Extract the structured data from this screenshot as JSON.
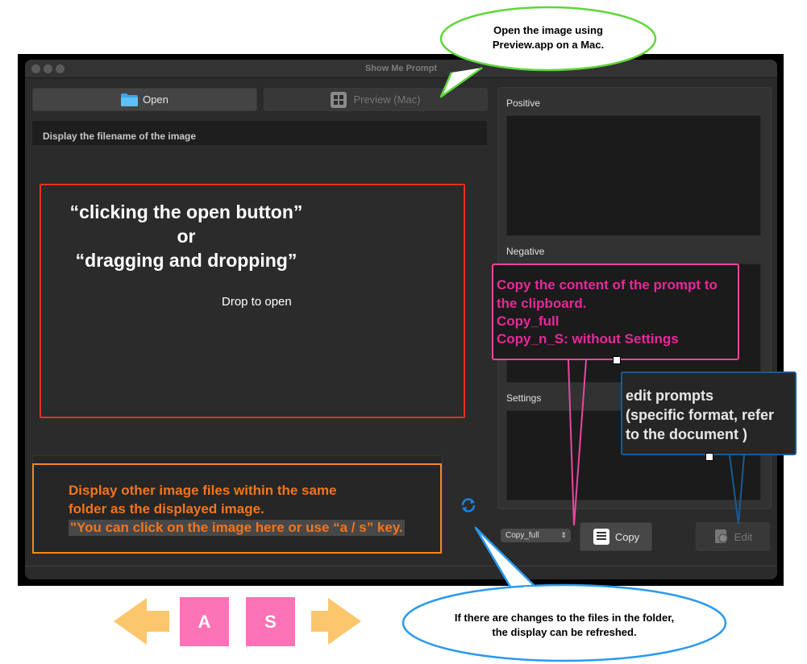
{
  "window": {
    "title": "Show Me Prompt"
  },
  "toolbar": {
    "open_label": "Open",
    "preview_label": "Preview (Mac)"
  },
  "filename": {
    "text": "Display the filename of the image"
  },
  "drop": {
    "label": "Drop to open"
  },
  "prompts": {
    "positive_label": "Positive",
    "negative_label": "Negative",
    "settings_label": "Settings"
  },
  "controls": {
    "copy_mode": "Copy_full",
    "copy_label": "Copy",
    "edit_label": "Edit"
  },
  "annotations": {
    "open_hint": [
      "“clicking the open button”",
      "or",
      "“dragging and dropping”"
    ],
    "preview_bubble": [
      "Open the image using",
      "Preview.app on a Mac."
    ],
    "thumbs_hint": [
      "Display other image files within the same",
      "folder as the displayed image.",
      "\"You can click on the image here or use “a / s” key."
    ],
    "copy_hint": [
      "Copy the content of the prompt to",
      "the clipboard.",
      "Copy_full",
      "Copy_n_S: without Settings"
    ],
    "edit_hint": [
      "edit prompts",
      "(specific format, refer",
      "to the document )"
    ],
    "refresh_bubble": [
      "If there are changes to the files in the folder,",
      "the display can be refreshed."
    ],
    "keys": {
      "a": "A",
      "s": "S"
    }
  },
  "colors": {
    "red": "#e8301e",
    "orange": "#f28a1e",
    "pink": "#e8489e",
    "navy": "#1a5a93",
    "green": "#5fd63a",
    "blue": "#2a9af0",
    "key": "#fc73b7",
    "arrow": "#fbc66c"
  }
}
